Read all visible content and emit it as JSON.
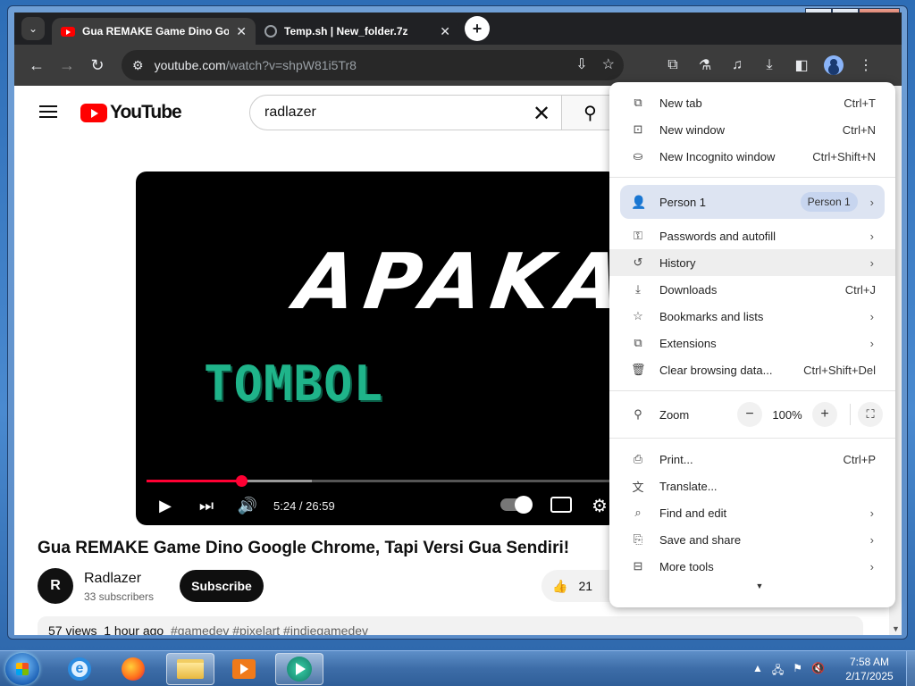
{
  "browser": {
    "tabs": [
      {
        "title": "Gua REMAKE Game Dino Goog",
        "close": "✕"
      },
      {
        "title": "Temp.sh | New_folder.7z",
        "close": "✕"
      }
    ],
    "new_tab": "+",
    "url_host": "youtube.com",
    "url_path": "/watch?v=shpW81i5Tr8"
  },
  "youtube": {
    "logo_text": "YouTube",
    "search_value": "radlazer",
    "video": {
      "overlay_big": "APAKAH",
      "overlay_small": "TOMBOL",
      "time": "5:24 / 26:59",
      "progress_fraction": 0.2,
      "title": "Gua REMAKE Game Dino Google Chrome, Tapi Versi Gua Sendiri!"
    },
    "channel": {
      "name": "Radlazer",
      "subscribers": "33 subscribers",
      "subscribe_label": "Subscribe"
    },
    "likes": "21",
    "description": {
      "views": "57 views",
      "age": "1 hour ago",
      "tags": "#gamedev #pixelart #indiegamedev"
    }
  },
  "menu": {
    "group1": [
      {
        "label": "New tab",
        "shortcut": "Ctrl+T",
        "icon": "new-tab-icon"
      },
      {
        "label": "New window",
        "shortcut": "Ctrl+N",
        "icon": "new-window-icon"
      },
      {
        "label": "New Incognito window",
        "shortcut": "Ctrl+Shift+N",
        "icon": "incognito-icon"
      }
    ],
    "person": {
      "label": "Person 1",
      "pill": "Person 1"
    },
    "group2": [
      {
        "label": "Passwords and autofill",
        "shortcut": "",
        "icon": "key-icon"
      },
      {
        "label": "History",
        "shortcut": "",
        "icon": "history-icon"
      },
      {
        "label": "Downloads",
        "shortcut": "Ctrl+J",
        "icon": "download-icon"
      },
      {
        "label": "Bookmarks and lists",
        "shortcut": "",
        "icon": "star-icon"
      },
      {
        "label": "Extensions",
        "shortcut": "",
        "icon": "puzzle-icon"
      },
      {
        "label": "Clear browsing data...",
        "shortcut": "Ctrl+Shift+Del",
        "icon": "trash-icon"
      }
    ],
    "zoom": {
      "label": "Zoom",
      "value": "100%",
      "minus": "−",
      "plus": "+"
    },
    "group3": [
      {
        "label": "Print...",
        "shortcut": "Ctrl+P",
        "icon": "print-icon"
      },
      {
        "label": "Translate...",
        "shortcut": "",
        "icon": "translate-icon"
      },
      {
        "label": "Find and edit",
        "shortcut": "",
        "icon": "find-icon"
      },
      {
        "label": "Save and share",
        "shortcut": "",
        "icon": "save-icon"
      },
      {
        "label": "More tools",
        "shortcut": "",
        "icon": "toolbox-icon"
      }
    ]
  },
  "taskbar": {
    "time": "7:58 AM",
    "date": "2/17/2025"
  }
}
